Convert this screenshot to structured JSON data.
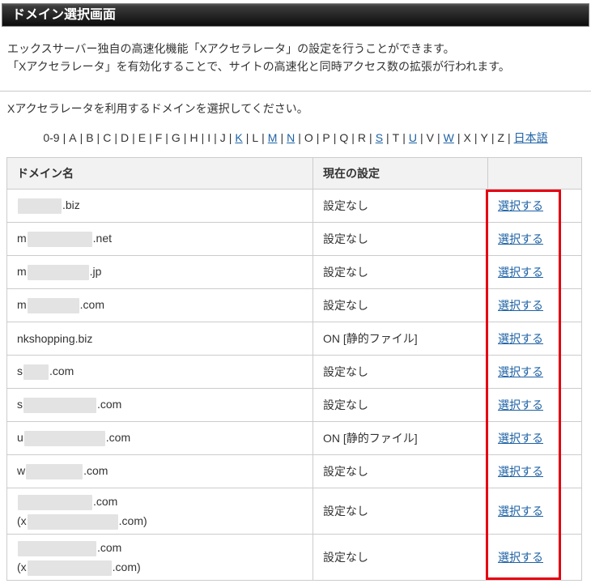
{
  "page": {
    "title": "ドメイン選択画面",
    "intro_line1": "エックスサーバー独自の高速化機能「Xアクセラレータ」の設定を行うことができます。",
    "intro_line2": "「Xアクセラレータ」を有効化することで、サイトの高速化と同時アクセス数の拡張が行われます。",
    "instruction": "Xアクセラレータを利用するドメインを選択してください。"
  },
  "index_nav": {
    "separator": "|",
    "items": [
      {
        "label": "0-9",
        "link": false
      },
      {
        "label": "A",
        "link": false
      },
      {
        "label": "B",
        "link": false
      },
      {
        "label": "C",
        "link": false
      },
      {
        "label": "D",
        "link": false
      },
      {
        "label": "E",
        "link": false
      },
      {
        "label": "F",
        "link": false
      },
      {
        "label": "G",
        "link": false
      },
      {
        "label": "H",
        "link": false
      },
      {
        "label": "I",
        "link": false
      },
      {
        "label": "J",
        "link": false
      },
      {
        "label": "K",
        "link": true
      },
      {
        "label": "L",
        "link": false
      },
      {
        "label": "M",
        "link": true
      },
      {
        "label": "N",
        "link": true
      },
      {
        "label": "O",
        "link": false
      },
      {
        "label": "P",
        "link": false
      },
      {
        "label": "Q",
        "link": false
      },
      {
        "label": "R",
        "link": false
      },
      {
        "label": "S",
        "link": true
      },
      {
        "label": "T",
        "link": false
      },
      {
        "label": "U",
        "link": true
      },
      {
        "label": "V",
        "link": false
      },
      {
        "label": "W",
        "link": true
      },
      {
        "label": "X",
        "link": false
      },
      {
        "label": "Y",
        "link": false
      },
      {
        "label": "Z",
        "link": false
      },
      {
        "label": "日本語",
        "link": true
      }
    ]
  },
  "table": {
    "headers": [
      "ドメイン名",
      "現在の設定",
      ""
    ],
    "action_label": "選択する",
    "setting_none": "設定なし",
    "setting_on_static": "ON [静的ファイル]",
    "rows": [
      {
        "domain": [
          {
            "redacted": 54
          },
          {
            "text": ".biz"
          }
        ],
        "setting": "設定なし"
      },
      {
        "domain": [
          {
            "text": "m"
          },
          {
            "redacted": 80
          },
          {
            "text": ".net"
          }
        ],
        "setting": "設定なし"
      },
      {
        "domain": [
          {
            "text": "m"
          },
          {
            "redacted": 76
          },
          {
            "text": ".jp"
          }
        ],
        "setting": "設定なし"
      },
      {
        "domain": [
          {
            "text": "m"
          },
          {
            "redacted": 64
          },
          {
            "text": ".com"
          }
        ],
        "setting": "設定なし"
      },
      {
        "domain": [
          {
            "text": "nkshopping.biz"
          }
        ],
        "setting": "ON [静的ファイル]"
      },
      {
        "domain": [
          {
            "text": "s"
          },
          {
            "redacted": 31
          },
          {
            "text": ".com"
          }
        ],
        "setting": "設定なし"
      },
      {
        "domain": [
          {
            "text": "s"
          },
          {
            "redacted": 90
          },
          {
            "text": ".com"
          }
        ],
        "setting": "設定なし"
      },
      {
        "domain": [
          {
            "text": "u"
          },
          {
            "redacted": 100
          },
          {
            "text": ".com"
          }
        ],
        "setting": "ON [静的ファイル]"
      },
      {
        "domain": [
          {
            "text": "w"
          },
          {
            "redacted": 70
          },
          {
            "text": ".com"
          }
        ],
        "setting": "設定なし"
      },
      {
        "domain": [
          {
            "redacted": 92
          },
          {
            "text": ".com"
          },
          {
            "break": true
          },
          {
            "text": "(x"
          },
          {
            "redacted": 112
          },
          {
            "text": ".com)"
          }
        ],
        "setting": "設定なし"
      },
      {
        "domain": [
          {
            "redacted": 97
          },
          {
            "text": ".com"
          },
          {
            "break": true
          },
          {
            "text": "(x"
          },
          {
            "redacted": 104
          },
          {
            "text": ".com)"
          }
        ],
        "setting": "設定なし"
      }
    ]
  },
  "colors": {
    "link_blue": "#1e62a5",
    "highlight_red": "#e60012",
    "header_bg": "#f2f2f2",
    "title_bar_text": "#ffffff"
  }
}
